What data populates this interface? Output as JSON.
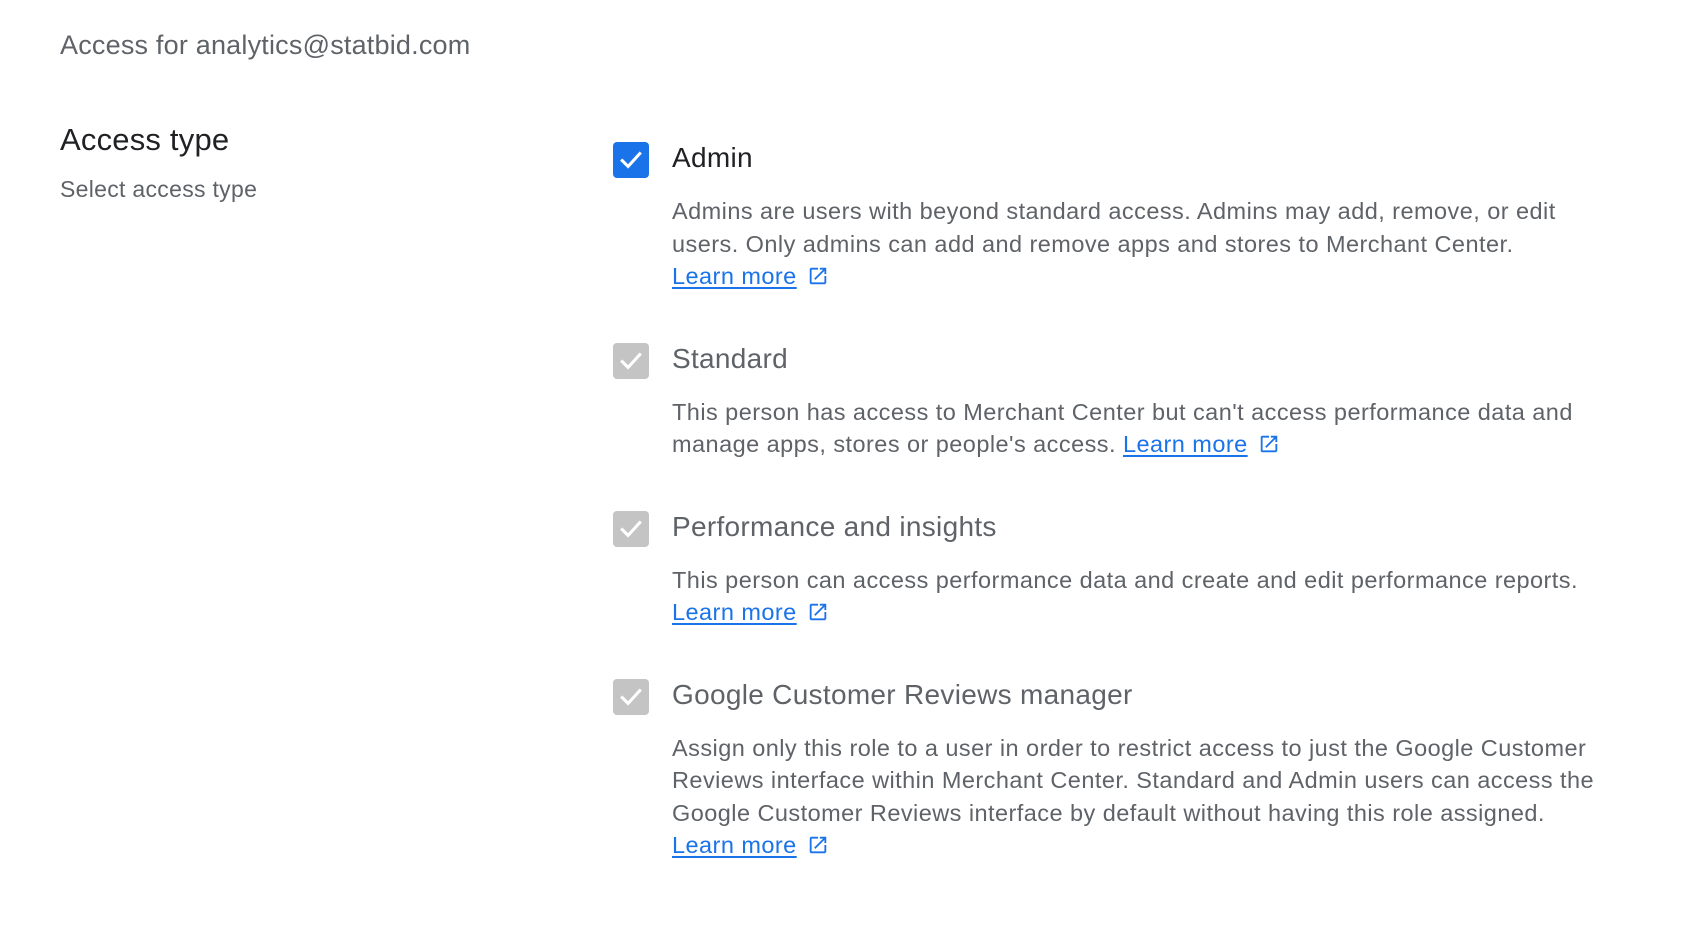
{
  "header": {
    "email_label": "Access for analytics@statbid.com"
  },
  "section": {
    "title": "Access type",
    "subtitle": "Select access type"
  },
  "options": [
    {
      "label": "Admin",
      "checked": true,
      "disabled": false,
      "description": "Admins are users with beyond standard access. Admins may add, remove, or edit users. Only admins can add and remove apps and stores to Merchant Center.",
      "link": "Learn more"
    },
    {
      "label": "Standard",
      "checked": true,
      "disabled": true,
      "description": "This person has access to Merchant Center but can't access performance data and manage apps, stores or people's access.",
      "link": "Learn more"
    },
    {
      "label": "Performance and insights",
      "checked": true,
      "disabled": true,
      "description": "This person can access performance data and create and edit performance reports.",
      "link": "Learn more"
    },
    {
      "label": "Google Customer Reviews manager",
      "checked": true,
      "disabled": true,
      "description": "Assign only this role to a user in order to restrict access to just the Google Customer Reviews interface within Merchant Center. Standard and Admin users can access the Google Customer Reviews interface by default without having this role assigned.",
      "link": "Learn more"
    }
  ],
  "icons": {
    "checkbox_check": "check-icon",
    "link_external": "open-in-new-icon"
  },
  "colors": {
    "accent": "#1a73e8",
    "disabled_checkbox": "#c4c4c4",
    "text_primary": "#202124",
    "text_secondary": "#5f6368"
  }
}
